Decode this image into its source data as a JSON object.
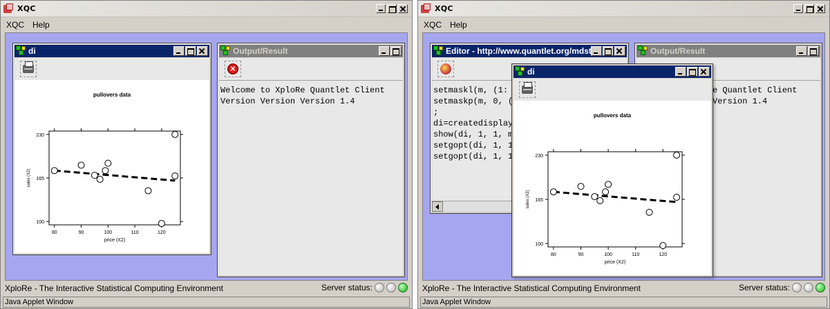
{
  "app": {
    "title": "XQC",
    "menu": [
      "XQC",
      "Help"
    ],
    "status_text": "XploRe - The Interactive Statistical Computing Environment",
    "server_status_label": "Server status:",
    "applet_window_label": "Java Applet Window"
  },
  "plot": {
    "title": "pullovers data",
    "xlabel": "price (X2)",
    "ylabel": "sales (X2)",
    "x_ticks": [
      "80",
      "90",
      "100",
      "110",
      "120"
    ],
    "y_ticks": [
      "100",
      "165",
      "230"
    ]
  },
  "chart_data": {
    "type": "scatter",
    "title": "pullovers data",
    "xlabel": "price (X2)",
    "ylabel": "sales (X2)",
    "xlim": [
      78,
      127
    ],
    "ylim": [
      95,
      235
    ],
    "points": [
      {
        "x": 80,
        "y": 176
      },
      {
        "x": 90,
        "y": 184
      },
      {
        "x": 95,
        "y": 169
      },
      {
        "x": 97,
        "y": 163
      },
      {
        "x": 99,
        "y": 176
      },
      {
        "x": 100,
        "y": 187
      },
      {
        "x": 115,
        "y": 146
      },
      {
        "x": 120,
        "y": 97
      },
      {
        "x": 125,
        "y": 230
      },
      {
        "x": 125,
        "y": 168
      }
    ],
    "regression_line": {
      "x": [
        80,
        125
      ],
      "y": [
        176,
        161
      ]
    }
  },
  "left": {
    "di_window": {
      "title": "di"
    },
    "output_window": {
      "title": "Output/Result",
      "lines": [
        "Welcome to XploRe Quantlet Client",
        "Version Version Version 1.4"
      ]
    }
  },
  "right": {
    "editor_window": {
      "title": "Editor - http://www.quantlet.org/mdsta",
      "lines": [
        "setmaskl(m, (1:",
        "setmaskp(m, 0, (",
        ";",
        "di=createdisplay",
        "show(di, 1, 1, m",
        "setgopt(di, 1, 1",
        "setgopt(di, 1, 1"
      ]
    },
    "output_window": {
      "title": "Output/Result",
      "lines": [
        "e Quantlet Client",
        "Version 1.4"
      ]
    },
    "di_window": {
      "title": "di"
    }
  }
}
